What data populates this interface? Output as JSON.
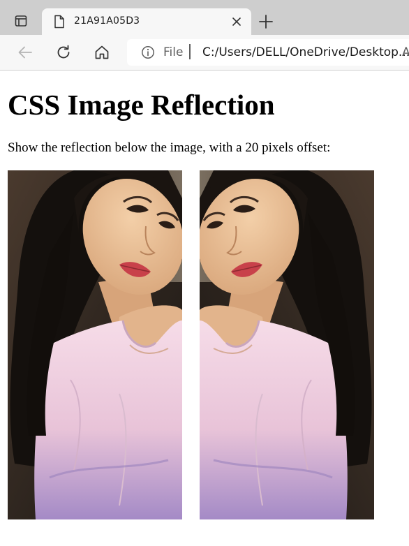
{
  "browser": {
    "tab": {
      "title": "21A91A05D3"
    },
    "address_bar": {
      "scheme_label": "File",
      "url": "C:/Users/DELL/OneDrive/Desktop...",
      "overflow_text": "A"
    },
    "icons": [
      "tab-actions-icon",
      "page-icon",
      "close-icon",
      "plus-icon",
      "back-arrow-icon",
      "refresh-icon",
      "home-icon",
      "info-icon"
    ]
  },
  "page": {
    "title": "CSS Image Reflection",
    "description": "Show the reflection below the image, with a 20 pixels offset:"
  },
  "colors": {
    "tabstrip": "#cecece",
    "toolbar": "#f7f7f7",
    "page_bg": "#ffffff"
  }
}
